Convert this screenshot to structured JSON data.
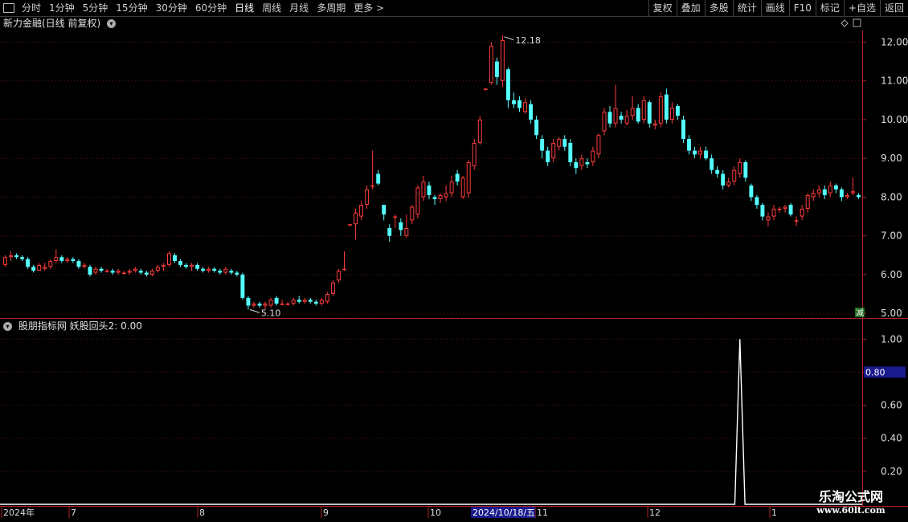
{
  "toolbar": {
    "periods": [
      "分时",
      "1分钟",
      "5分钟",
      "15分钟",
      "30分钟",
      "60分钟",
      "日线",
      "周线",
      "月线",
      "多周期",
      "更多 >"
    ],
    "active": "日线",
    "right_buttons": [
      "复权",
      "叠加",
      "多股",
      "统计",
      "画线",
      "F10",
      "标记",
      "+自选",
      "返回"
    ]
  },
  "main_panel": {
    "title": "新力金融(日线 前复权)",
    "y_ticks": [
      "12.00",
      "11.00",
      "10.00",
      "9.00",
      "8.00",
      "7.00",
      "6.00",
      "5.00"
    ],
    "high_label": "12.18",
    "low_label": "5.10",
    "reduce_btn": "减"
  },
  "indicator_panel": {
    "title": "股朋指标网  妖股回头2: 0.00",
    "y_ticks": [
      "1.00",
      "0.80",
      "0.60",
      "0.40",
      "0.20"
    ],
    "cursor_value": "0.80"
  },
  "x_axis": {
    "labels": [
      "2024年",
      "7",
      "8",
      "9",
      "10",
      "11",
      "12",
      "1"
    ],
    "cursor_date": "2024/10/18/五"
  },
  "watermark": {
    "line1": "乐淘公式网",
    "line2": "www.60lt.com"
  },
  "colors": {
    "up": "#ff3c3c",
    "down": "#54ffff",
    "axis": "#b02020",
    "grid": "#5a1a1a"
  },
  "chart_data": {
    "type": "candlestick",
    "ylim": [
      4.9,
      12.3
    ],
    "candles": [
      [
        6.25,
        6.45,
        6.2,
        6.5
      ],
      [
        6.45,
        6.5,
        6.35,
        6.6
      ],
      [
        6.5,
        6.45,
        6.4,
        6.55
      ],
      [
        6.45,
        6.4,
        6.35,
        6.5
      ],
      [
        6.4,
        6.2,
        6.15,
        6.45
      ],
      [
        6.2,
        6.1,
        6.05,
        6.25
      ],
      [
        6.1,
        6.25,
        6.1,
        6.3
      ],
      [
        6.15,
        6.2,
        6.1,
        6.3
      ],
      [
        6.2,
        6.35,
        6.15,
        6.4
      ],
      [
        6.35,
        6.45,
        6.3,
        6.65
      ],
      [
        6.45,
        6.35,
        6.3,
        6.5
      ],
      [
        6.35,
        6.4,
        6.3,
        6.45
      ],
      [
        6.4,
        6.35,
        6.3,
        6.45
      ],
      [
        6.35,
        6.2,
        6.15,
        6.4
      ],
      [
        6.2,
        6.25,
        6.15,
        6.3
      ],
      [
        6.2,
        6.0,
        5.95,
        6.25
      ],
      [
        6.05,
        6.15,
        6.0,
        6.2
      ],
      [
        6.15,
        6.1,
        6.05,
        6.2
      ],
      [
        6.1,
        6.1,
        6.05,
        6.15
      ],
      [
        6.1,
        6.05,
        6.0,
        6.15
      ],
      [
        6.05,
        6.1,
        6.0,
        6.15
      ],
      [
        6.05,
        6.05,
        6.0,
        6.1
      ],
      [
        6.05,
        6.1,
        6.0,
        6.15
      ],
      [
        6.1,
        6.15,
        6.05,
        6.2
      ],
      [
        6.1,
        6.05,
        6.0,
        6.15
      ],
      [
        6.05,
        6.0,
        5.95,
        6.1
      ],
      [
        6.0,
        6.1,
        5.95,
        6.15
      ],
      [
        6.1,
        6.2,
        6.05,
        6.25
      ],
      [
        6.2,
        6.25,
        6.1,
        6.3
      ],
      [
        6.25,
        6.55,
        6.2,
        6.6
      ],
      [
        6.5,
        6.35,
        6.3,
        6.55
      ],
      [
        6.35,
        6.25,
        6.2,
        6.4
      ],
      [
        6.25,
        6.2,
        6.15,
        6.3
      ],
      [
        6.2,
        6.25,
        6.1,
        6.3
      ],
      [
        6.25,
        6.15,
        6.1,
        6.3
      ],
      [
        6.15,
        6.1,
        6.05,
        6.2
      ],
      [
        6.1,
        6.15,
        6.05,
        6.2
      ],
      [
        6.15,
        6.1,
        6.05,
        6.2
      ],
      [
        6.1,
        6.05,
        6.0,
        6.15
      ],
      [
        6.05,
        6.15,
        6.0,
        6.2
      ],
      [
        6.1,
        6.05,
        6.0,
        6.15
      ],
      [
        6.05,
        6.0,
        5.95,
        6.1
      ],
      [
        6.0,
        5.4,
        5.35,
        6.05
      ],
      [
        5.4,
        5.2,
        5.1,
        5.45
      ],
      [
        5.2,
        5.25,
        5.15,
        5.3
      ],
      [
        5.25,
        5.2,
        5.15,
        5.3
      ],
      [
        5.2,
        5.25,
        5.1,
        5.3
      ],
      [
        5.2,
        5.35,
        5.15,
        5.4
      ],
      [
        5.4,
        5.25,
        5.2,
        5.45
      ],
      [
        5.25,
        5.25,
        5.2,
        5.35
      ],
      [
        5.25,
        5.25,
        5.2,
        5.3
      ],
      [
        5.25,
        5.35,
        5.2,
        5.4
      ],
      [
        5.35,
        5.3,
        5.25,
        5.45
      ],
      [
        5.3,
        5.35,
        5.25,
        5.4
      ],
      [
        5.35,
        5.3,
        5.25,
        5.4
      ],
      [
        5.3,
        5.25,
        5.2,
        5.35
      ],
      [
        5.25,
        5.35,
        5.2,
        5.4
      ],
      [
        5.3,
        5.5,
        5.25,
        5.55
      ],
      [
        5.5,
        5.8,
        5.45,
        5.85
      ],
      [
        5.85,
        6.1,
        5.8,
        6.15
      ],
      [
        6.15,
        6.15,
        6.1,
        6.6
      ],
      [
        7.3,
        7.3,
        7.25,
        7.3
      ],
      [
        7.3,
        7.6,
        6.9,
        7.7
      ],
      [
        7.5,
        7.8,
        7.4,
        7.9
      ],
      [
        7.8,
        8.2,
        7.7,
        8.3
      ],
      [
        8.3,
        8.3,
        8.2,
        9.2
      ],
      [
        8.6,
        8.35,
        8.3,
        8.7
      ],
      [
        7.8,
        7.55,
        7.4,
        7.8
      ],
      [
        7.2,
        7.0,
        6.85,
        7.3
      ],
      [
        7.5,
        7.5,
        7.2,
        7.55
      ],
      [
        7.35,
        7.15,
        7.0,
        7.45
      ],
      [
        7.0,
        7.2,
        6.95,
        7.55
      ],
      [
        7.4,
        7.75,
        7.3,
        7.8
      ],
      [
        7.55,
        8.25,
        7.45,
        8.3
      ],
      [
        8.0,
        8.4,
        7.9,
        8.55
      ],
      [
        8.3,
        8.05,
        7.95,
        8.4
      ],
      [
        8.0,
        7.95,
        7.8,
        8.05
      ],
      [
        7.95,
        8.05,
        7.85,
        8.1
      ],
      [
        8.0,
        8.1,
        7.9,
        8.3
      ],
      [
        8.1,
        8.4,
        8.0,
        8.55
      ],
      [
        8.6,
        8.4,
        8.3,
        8.7
      ],
      [
        8.0,
        8.5,
        7.95,
        8.55
      ],
      [
        8.1,
        8.9,
        8.0,
        8.95
      ],
      [
        8.8,
        9.4,
        8.7,
        9.5
      ],
      [
        9.4,
        10.0,
        9.35,
        10.1
      ],
      [
        10.8,
        10.8,
        10.75,
        10.8
      ],
      [
        10.95,
        11.9,
        10.9,
        12.0
      ],
      [
        11.5,
        11.1,
        10.9,
        11.6
      ],
      [
        11.0,
        12.05,
        10.85,
        12.18
      ],
      [
        11.3,
        10.5,
        10.3,
        11.35
      ],
      [
        10.5,
        10.4,
        10.3,
        10.7
      ],
      [
        10.5,
        10.3,
        10.2,
        10.6
      ],
      [
        10.2,
        10.45,
        10.15,
        10.55
      ],
      [
        10.4,
        10.0,
        9.9,
        10.5
      ],
      [
        10.0,
        9.6,
        9.5,
        10.1
      ],
      [
        9.5,
        9.2,
        9.0,
        9.6
      ],
      [
        9.2,
        8.9,
        8.8,
        9.3
      ],
      [
        9.0,
        9.4,
        8.9,
        9.5
      ],
      [
        9.3,
        9.5,
        9.2,
        9.55
      ],
      [
        9.5,
        9.3,
        9.2,
        9.6
      ],
      [
        9.4,
        8.9,
        8.8,
        9.5
      ],
      [
        8.9,
        8.75,
        8.6,
        9.0
      ],
      [
        8.8,
        9.0,
        8.7,
        9.1
      ],
      [
        8.9,
        8.85,
        8.75,
        9.0
      ],
      [
        8.9,
        9.2,
        8.8,
        9.3
      ],
      [
        9.1,
        9.6,
        9.0,
        9.65
      ],
      [
        9.7,
        10.2,
        9.6,
        10.3
      ],
      [
        10.2,
        9.9,
        9.8,
        10.35
      ],
      [
        9.9,
        10.3,
        9.8,
        10.9
      ],
      [
        10.1,
        10.0,
        9.9,
        10.2
      ],
      [
        9.9,
        10.1,
        9.85,
        10.25
      ],
      [
        10.1,
        10.3,
        10.0,
        10.6
      ],
      [
        10.3,
        9.95,
        9.9,
        10.4
      ],
      [
        10.0,
        10.5,
        9.9,
        10.6
      ],
      [
        10.45,
        9.9,
        9.8,
        10.5
      ],
      [
        9.85,
        9.9,
        9.75,
        10.0
      ],
      [
        9.9,
        10.6,
        9.8,
        10.7
      ],
      [
        10.65,
        10.0,
        9.9,
        10.8
      ],
      [
        10.0,
        10.3,
        9.9,
        10.45
      ],
      [
        10.35,
        10.1,
        10.0,
        10.4
      ],
      [
        10.0,
        9.5,
        9.4,
        10.1
      ],
      [
        9.5,
        9.2,
        9.1,
        9.6
      ],
      [
        9.2,
        9.1,
        9.0,
        9.3
      ],
      [
        9.1,
        9.2,
        9.0,
        9.3
      ],
      [
        9.2,
        9.0,
        8.95,
        9.3
      ],
      [
        9.0,
        8.7,
        8.6,
        9.1
      ],
      [
        8.7,
        8.6,
        8.5,
        8.8
      ],
      [
        8.6,
        8.3,
        8.2,
        8.7
      ],
      [
        8.3,
        8.4,
        8.25,
        8.5
      ],
      [
        8.4,
        8.7,
        8.3,
        8.8
      ],
      [
        8.6,
        8.9,
        8.5,
        9.0
      ],
      [
        8.9,
        8.5,
        8.4,
        8.95
      ],
      [
        8.3,
        8.0,
        7.9,
        8.35
      ],
      [
        8.0,
        7.8,
        7.7,
        8.05
      ],
      [
        7.8,
        7.5,
        7.4,
        7.85
      ],
      [
        7.4,
        7.5,
        7.25,
        7.6
      ],
      [
        7.5,
        7.7,
        7.4,
        7.8
      ],
      [
        7.7,
        7.7,
        7.6,
        7.75
      ],
      [
        7.7,
        7.75,
        7.6,
        7.8
      ],
      [
        7.8,
        7.55,
        7.5,
        7.85
      ],
      [
        7.4,
        7.4,
        7.25,
        7.5
      ],
      [
        7.5,
        7.7,
        7.4,
        7.8
      ],
      [
        7.7,
        8.05,
        7.6,
        8.1
      ],
      [
        8.0,
        8.1,
        7.9,
        8.2
      ],
      [
        8.1,
        8.2,
        8.0,
        8.3
      ],
      [
        8.2,
        8.05,
        7.95,
        8.3
      ],
      [
        8.1,
        8.3,
        8.0,
        8.4
      ],
      [
        8.3,
        8.2,
        8.1,
        8.35
      ],
      [
        8.2,
        8.0,
        7.9,
        8.25
      ],
      [
        8.0,
        8.05,
        7.95,
        8.1
      ],
      [
        8.1,
        8.15,
        8.05,
        8.5
      ],
      [
        8.05,
        8.0,
        7.95,
        8.1
      ]
    ],
    "indicator": {
      "signal_index": 130,
      "signal_value": 1.0,
      "baseline": 0.0,
      "ylim": [
        0,
        1.05
      ]
    }
  }
}
